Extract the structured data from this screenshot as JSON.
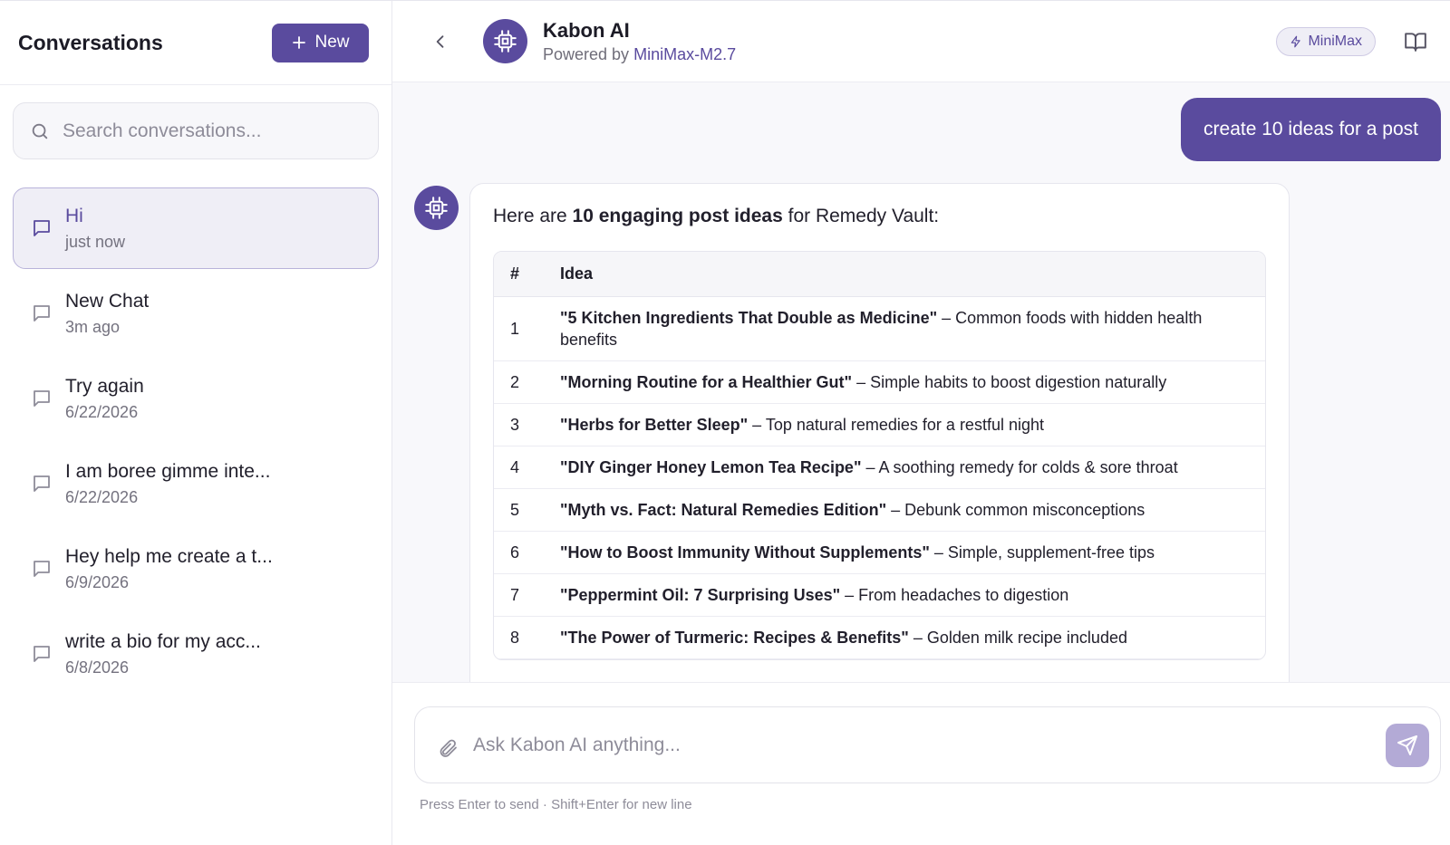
{
  "sidebar": {
    "title": "Conversations",
    "new_label": "New",
    "search_placeholder": "Search conversations...",
    "conversations": [
      {
        "title": "Hi",
        "time": "just now",
        "active": true
      },
      {
        "title": "New Chat",
        "time": "3m ago"
      },
      {
        "title": "Try again",
        "time": "6/22/2026"
      },
      {
        "title": "I am boree gimme inte...",
        "time": "6/22/2026"
      },
      {
        "title": "Hey help me create a t...",
        "time": "6/9/2026"
      },
      {
        "title": "write a bio for my acc...",
        "time": "6/8/2026"
      }
    ]
  },
  "header": {
    "title": "Kabon AI",
    "powered_prefix": "Powered by",
    "model": "MiniMax-M2.7",
    "badge": "MiniMax"
  },
  "chat": {
    "user_message": "create 10 ideas for a post",
    "bot_intro": {
      "pre": "Here are",
      "bold": "10 engaging post ideas",
      "post": "for Remedy Vault:"
    },
    "table": {
      "headers": [
        "#",
        "Idea"
      ],
      "rows": [
        {
          "num": "1",
          "title": "\"5 Kitchen Ingredients That Double as Medicine\"",
          "desc": "– Common foods with hidden health benefits"
        },
        {
          "num": "2",
          "title": "\"Morning Routine for a Healthier Gut\"",
          "desc": "– Simple habits to boost digestion naturally"
        },
        {
          "num": "3",
          "title": "\"Herbs for Better Sleep\"",
          "desc": "– Top natural remedies for a restful night"
        },
        {
          "num": "4",
          "title": "\"DIY Ginger Honey Lemon Tea Recipe\"",
          "desc": "– A soothing remedy for colds & sore throat"
        },
        {
          "num": "5",
          "title": "\"Myth vs. Fact: Natural Remedies Edition\"",
          "desc": "– Debunk common misconceptions"
        },
        {
          "num": "6",
          "title": "\"How to Boost Immunity Without Supplements\"",
          "desc": "– Simple, supplement-free tips"
        },
        {
          "num": "7",
          "title": "\"Peppermint Oil: 7 Surprising Uses\"",
          "desc": "– From headaches to digestion"
        },
        {
          "num": "8",
          "title": "\"The Power of Turmeric: Recipes & Benefits\"",
          "desc": "– Golden milk recipe included"
        }
      ]
    }
  },
  "composer": {
    "placeholder": "Ask Kabon AI anything...",
    "hint": "Press Enter to send · Shift+Enter for new line"
  },
  "colors": {
    "accent": "#5a4b9e",
    "accent_light": "#efeef6",
    "send_disabled": "#b3aad6"
  }
}
